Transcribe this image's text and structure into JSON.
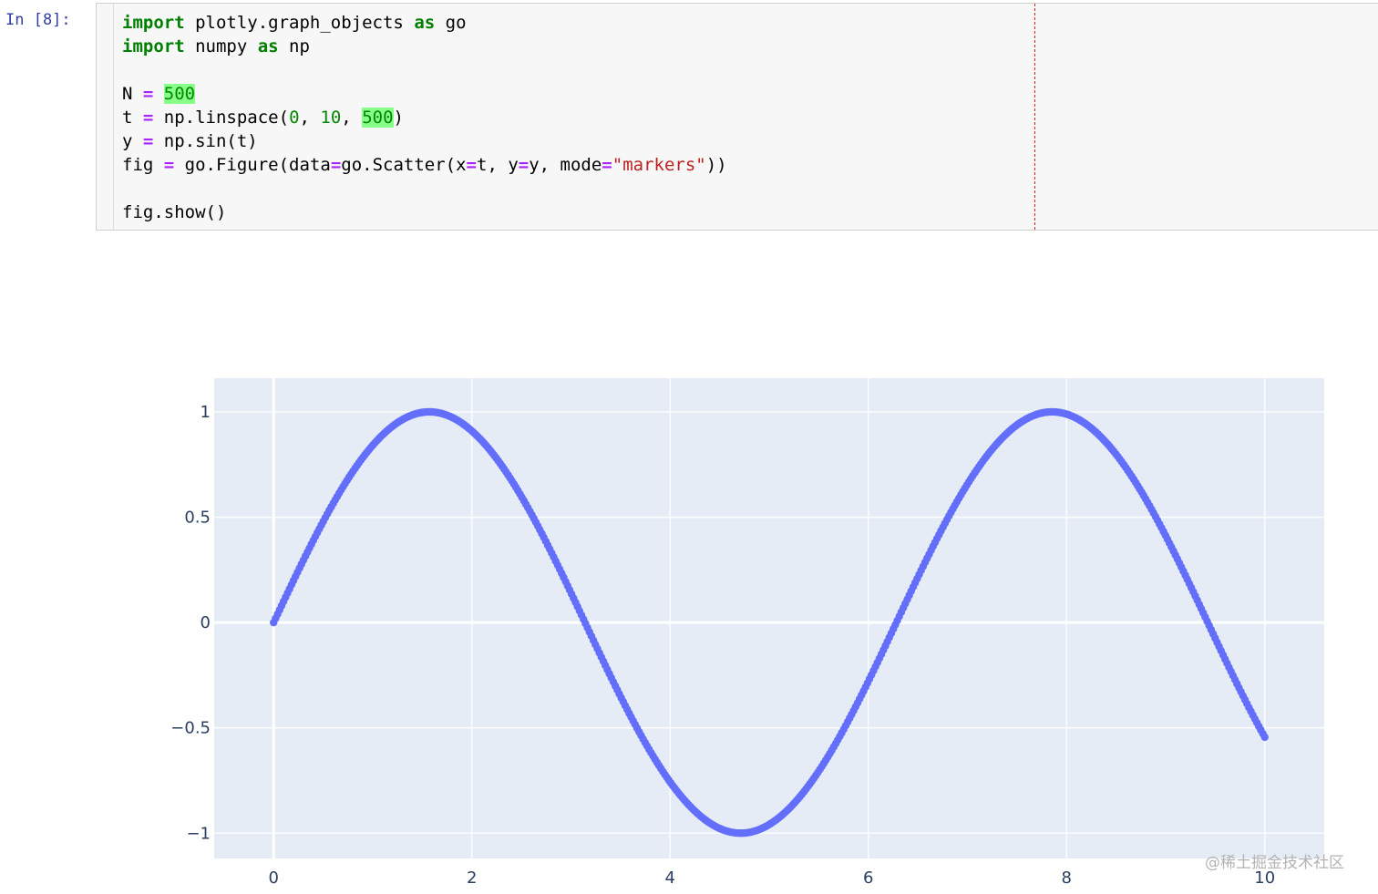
{
  "cell": {
    "prompt": "In [8]:",
    "code": {
      "l1_kw1": "import",
      "l1_t1": " plotly.graph_objects ",
      "l1_kw2": "as",
      "l1_t2": " go",
      "l2_kw1": "import",
      "l2_t1": " numpy ",
      "l2_kw2": "as",
      "l2_t2": " np",
      "l4_var": "N ",
      "l4_op": "=",
      "l4_sp": " ",
      "l4_num": "500",
      "l5_var": "t ",
      "l5_op": "=",
      "l5_t1": " np.linspace(",
      "l5_n1": "0",
      "l5_t2": ", ",
      "l5_n2": "10",
      "l5_t3": ", ",
      "l5_n3": "500",
      "l5_t4": ")",
      "l6_var": "y ",
      "l6_op": "=",
      "l6_t1": " np.sin(t)",
      "l7_var": "fig ",
      "l7_op": "=",
      "l7_t1": " go.Figure(data",
      "l7_op2": "=",
      "l7_t2": "go.Scatter(x",
      "l7_op3": "=",
      "l7_t3": "t, y",
      "l7_op4": "=",
      "l7_t4": "y, mode",
      "l7_op5": "=",
      "l7_str": "\"markers\"",
      "l7_t5": "))",
      "l9": "fig.show()"
    }
  },
  "chart_data": {
    "type": "scatter",
    "mode": "markers",
    "x_range": [
      0,
      10
    ],
    "n_points": 500,
    "series": [
      {
        "function": "sin(x)",
        "color": "#636efa"
      }
    ],
    "xlim": [
      -0.6,
      10.6
    ],
    "ylim": [
      -1.12,
      1.16
    ],
    "x_ticks": [
      0,
      2,
      4,
      6,
      8,
      10
    ],
    "x_tick_labels": [
      "0",
      "2",
      "4",
      "6",
      "8",
      "10"
    ],
    "y_ticks": [
      1,
      0.5,
      0,
      -0.5,
      -1
    ],
    "y_tick_labels": [
      "1",
      "0.5",
      "0",
      "−0.5",
      "−1"
    ],
    "plot_bg": "#e5ecf6",
    "grid": true,
    "grid_color": "#ffffff"
  },
  "watermark": "@稀土掘金技术社区"
}
